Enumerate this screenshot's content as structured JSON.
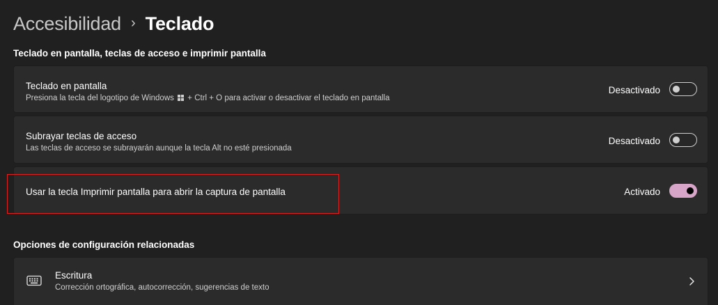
{
  "breadcrumb": {
    "parent": "Accesibilidad",
    "separator": "›",
    "current": "Teclado"
  },
  "section_keyboard": {
    "title": "Teclado en pantalla, teclas de acceso e imprimir pantalla"
  },
  "settings": [
    {
      "title": "Teclado en pantalla",
      "desc_before": "Presiona la tecla del logotipo de Windows",
      "desc_after": "+ Ctrl + O para activar o desactivar el teclado en pantalla",
      "state_label": "Desactivado",
      "enabled": false
    },
    {
      "title": "Subrayar teclas de acceso",
      "description": "Las teclas de acceso se subrayarán aunque la tecla Alt no esté presionada",
      "state_label": "Desactivado",
      "enabled": false
    },
    {
      "title": "Usar la tecla Imprimir pantalla para abrir la captura de pantalla",
      "state_label": "Activado",
      "enabled": true
    }
  ],
  "section_related": {
    "title": "Opciones de configuración relacionadas"
  },
  "related": {
    "icon": "keyboard-icon",
    "title": "Escritura",
    "description": "Corrección ortográfica, autocorrección, sugerencias de texto"
  },
  "colors": {
    "background": "#202020",
    "card": "#2b2b2b",
    "accent": "#d7a5c7",
    "highlight": "#e02020"
  }
}
